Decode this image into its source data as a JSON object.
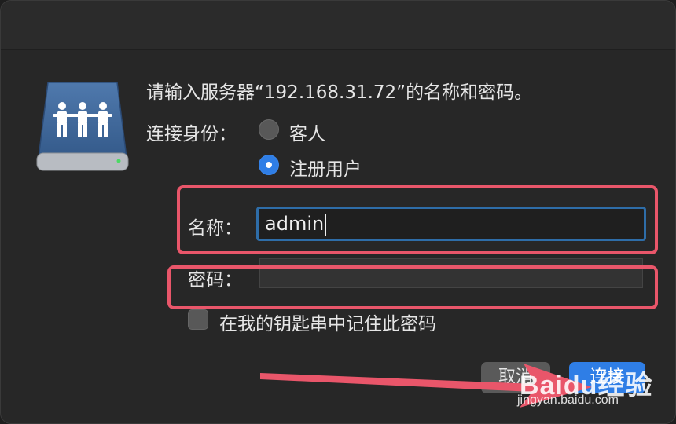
{
  "dialog": {
    "prompt": "请输入服务器“192.168.31.72”的名称和密码。",
    "connect_as_label": "连接身份：",
    "options": [
      {
        "label": "客人",
        "selected": false
      },
      {
        "label": "注册用户",
        "selected": true
      }
    ],
    "name_label": "名称：",
    "name_value": "admin",
    "password_label": "密码：",
    "password_value": "",
    "remember_label": "在我的钥匙串中记住此密码",
    "remember_checked": false,
    "cancel_label": "取消",
    "connect_label": "连接"
  },
  "colors": {
    "accent": "#2f7ee6",
    "highlight": "#e9566a",
    "background": "#272727"
  },
  "icons": {
    "server": "shared-server-people-icon",
    "arrow": "annotation-arrow"
  },
  "watermark": {
    "logo": "Baidu经验",
    "url": "jingyan.baidu.com"
  }
}
